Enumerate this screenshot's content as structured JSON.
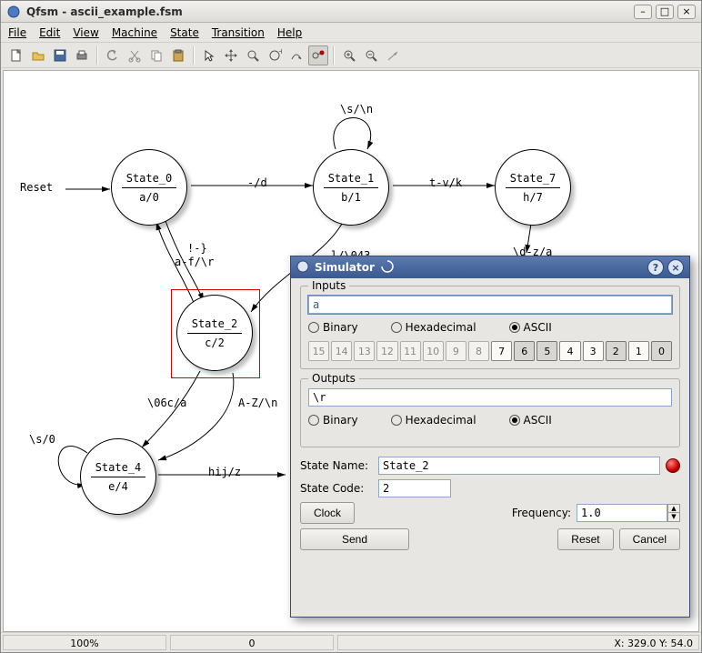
{
  "window": {
    "title": "Qfsm - ascii_example.fsm"
  },
  "menu": {
    "file": "File",
    "edit": "Edit",
    "view": "View",
    "machine": "Machine",
    "state": "State",
    "transition": "Transition",
    "help": "Help"
  },
  "statusbar": {
    "zoom": "100%",
    "selcount": "0",
    "coords": "X: 329.0  Y: 54.0"
  },
  "states": {
    "s0": {
      "name": "State_0",
      "out": "a/0"
    },
    "s1": {
      "name": "State_1",
      "out": "b/1"
    },
    "s2": {
      "name": "State_2",
      "out": "c/2"
    },
    "s4": {
      "name": "State_4",
      "out": "e/4"
    },
    "s7": {
      "name": "State_7",
      "out": "h/7"
    }
  },
  "labels": {
    "reset": "Reset",
    "t_s0_s1": "-/d",
    "t_s1_s7": "t-v/k",
    "t_s1_loop": "\\s/\\n",
    "t_s7_down": "\\d-z/a",
    "t_s0_s2a": "!-}",
    "t_s0_s2b": "a-f/\\r",
    "t_s1_s2": "l/\\043",
    "t_s2_s4a": "\\06c/a",
    "t_s2_s4b": "A-Z/\\n",
    "t_s4_loop": "\\s/0",
    "t_s4_right": "hij/z"
  },
  "simulator": {
    "title": "Simulator",
    "inputs_label": "Inputs",
    "inputs_value": "a",
    "outputs_label": "Outputs",
    "outputs_value": "\\r",
    "fmt_binary": "Binary",
    "fmt_hex": "Hexadecimal",
    "fmt_ascii": "ASCII",
    "bits": [
      "15",
      "14",
      "13",
      "12",
      "11",
      "10",
      "9",
      "8",
      "7",
      "6",
      "5",
      "4",
      "3",
      "2",
      "1",
      "0"
    ],
    "input_bits_enabled_from": 7,
    "input_bits_on": [
      6,
      5,
      2,
      0
    ],
    "state_name_label": "State Name:",
    "state_name_value": "State_2",
    "state_code_label": "State Code:",
    "state_code_value": "2",
    "btn_clock": "Clock",
    "freq_label": "Frequency:",
    "freq_value": "1.0",
    "btn_send": "Send",
    "btn_reset": "Reset",
    "btn_cancel": "Cancel"
  }
}
